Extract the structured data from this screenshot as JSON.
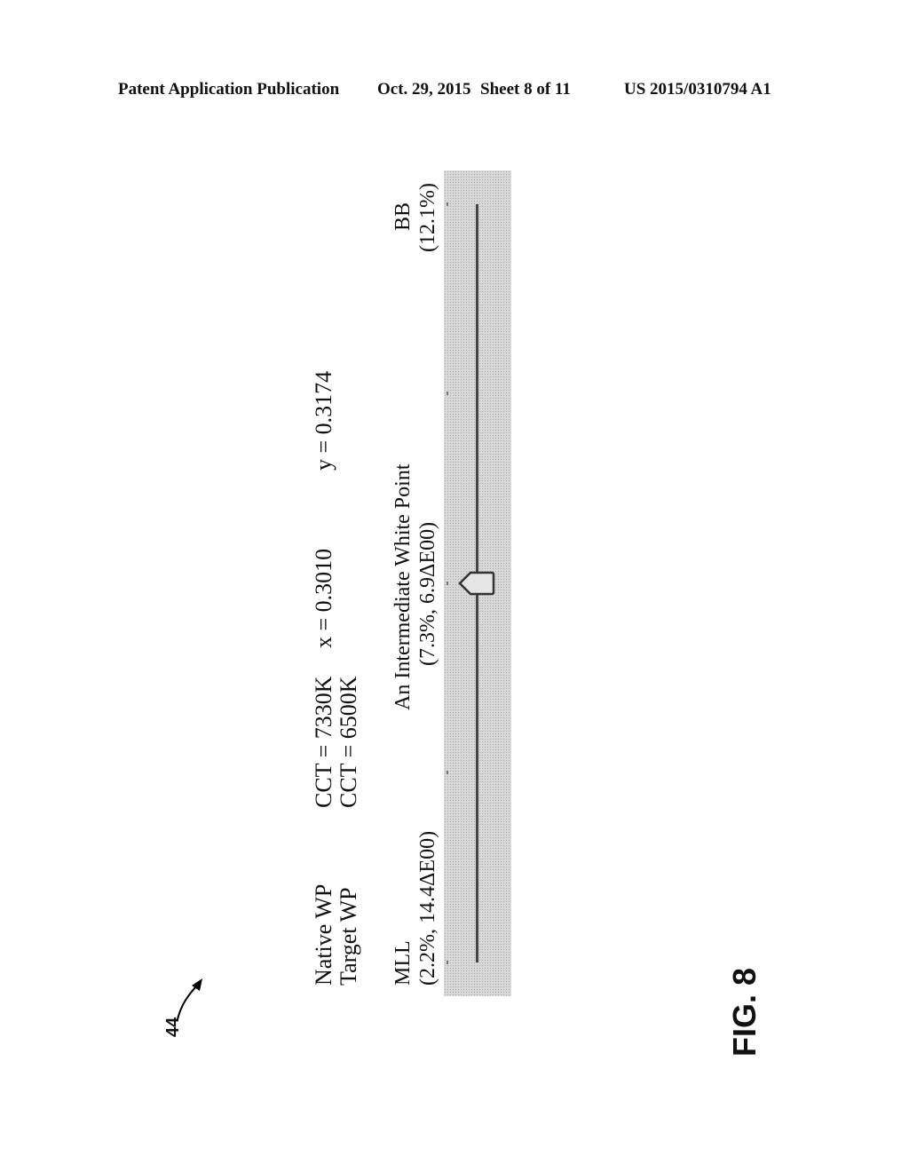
{
  "header": {
    "publication": "Patent Application Publication",
    "date": "Oct. 29, 2015",
    "sheet": "Sheet 8 of 11",
    "number": "US 2015/0310794 A1"
  },
  "figure": {
    "label": "FIG. 8",
    "reference_numeral": "44"
  },
  "panel": {
    "native": {
      "label": "Native WP",
      "cct": "CCT = 7330K",
      "x": "x = 0.3010",
      "y": "y = 0.3174"
    },
    "target": {
      "label": "Target WP",
      "cct": "CCT = 6500K"
    },
    "slider": {
      "left": {
        "name": "MLL",
        "detail": "(2.2%, 14.4ΔE00)"
      },
      "middle": {
        "name": "An Intermediate White Point",
        "detail": "(7.3%, 6.9ΔE00)"
      },
      "right": {
        "name": "BB",
        "detail": "(12.1%)"
      },
      "value_fraction": 0.5,
      "tick_count": 5
    }
  }
}
